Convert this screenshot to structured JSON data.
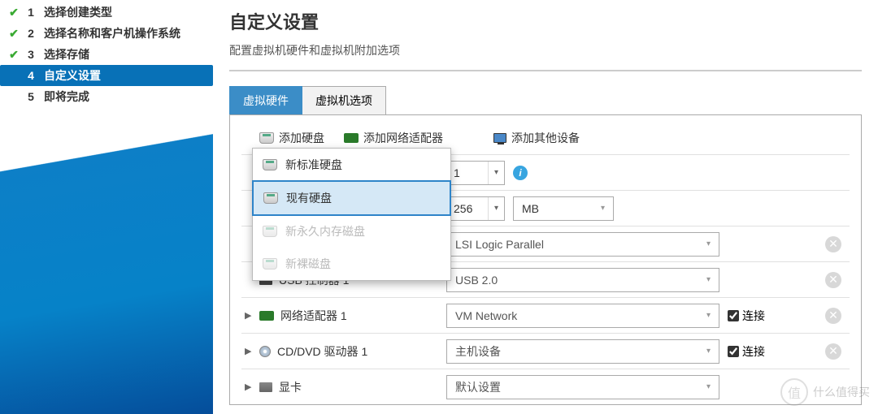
{
  "sidebar": {
    "steps": [
      {
        "num": "1",
        "label": "选择创建类型",
        "state": "done"
      },
      {
        "num": "2",
        "label": "选择名称和客户机操作系统",
        "state": "done"
      },
      {
        "num": "3",
        "label": "选择存储",
        "state": "done"
      },
      {
        "num": "4",
        "label": "自定义设置",
        "state": "active"
      },
      {
        "num": "5",
        "label": "即将完成",
        "state": "pending"
      }
    ]
  },
  "main": {
    "title": "自定义设置",
    "subtitle": "配置虚拟机硬件和虚拟机附加选项",
    "tabs": [
      {
        "label": "虚拟硬件",
        "active": true
      },
      {
        "label": "虚拟机选项",
        "active": false
      }
    ],
    "actions": {
      "add_disk": "添加硬盘",
      "add_nic": "添加网络适配器",
      "add_other": "添加其他设备"
    },
    "disk_menu": [
      {
        "label": "新标准硬盘",
        "state": "normal"
      },
      {
        "label": "现有硬盘",
        "state": "selected"
      },
      {
        "label": "新永久内存磁盘",
        "state": "disabled"
      },
      {
        "label": "新裸磁盘",
        "state": "disabled"
      }
    ],
    "cpu": {
      "value": "1"
    },
    "mem": {
      "value": "256",
      "unit": "MB"
    },
    "scsi": {
      "value": "LSI Logic Parallel"
    },
    "usb": {
      "label": "USB 控制器 1",
      "value": "USB 2.0"
    },
    "nic": {
      "label": "网络适配器 1",
      "value": "VM Network",
      "connect": "连接",
      "checked": true
    },
    "cd": {
      "label": "CD/DVD 驱动器 1",
      "value": "主机设备",
      "connect": "连接",
      "checked": true
    },
    "gpu": {
      "label": "显卡",
      "value": "默认设置"
    }
  },
  "watermark": {
    "badge": "值",
    "text": "什么值得买"
  }
}
